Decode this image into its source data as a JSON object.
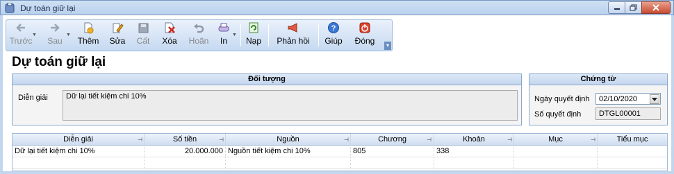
{
  "window": {
    "title": "Dự toán giữ lại"
  },
  "toolbar": {
    "buttons": [
      {
        "label": "Trước",
        "icon": "arrow-left-icon",
        "enabled": false
      },
      {
        "label": "Sau",
        "icon": "arrow-right-icon",
        "enabled": false
      },
      {
        "label": "Thêm",
        "icon": "add-document-icon",
        "enabled": true
      },
      {
        "label": "Sửa",
        "icon": "edit-icon",
        "enabled": true
      },
      {
        "label": "Cất",
        "icon": "save-disk-icon",
        "enabled": false
      },
      {
        "label": "Xóa",
        "icon": "delete-icon",
        "enabled": true
      },
      {
        "label": "Hoãn",
        "icon": "undo-icon",
        "enabled": false
      },
      {
        "label": "In",
        "icon": "printer-icon",
        "enabled": true
      },
      {
        "label": "Nạp",
        "icon": "refresh-icon",
        "enabled": true
      },
      {
        "label": "Phản hồi",
        "icon": "megaphone-icon",
        "enabled": true
      },
      {
        "label": "Giúp",
        "icon": "help-icon",
        "enabled": true
      },
      {
        "label": "Đóng",
        "icon": "power-icon",
        "enabled": true
      }
    ]
  },
  "page": {
    "title": "Dự toán giữ lại"
  },
  "doi_tuong": {
    "header": "Đối tượng",
    "dien_giai_label": "Diễn giải",
    "dien_giai_value": "Dữ lại tiết kiệm chi 10%"
  },
  "chung_tu": {
    "header": "Chứng từ",
    "ngay_label": "Ngày quyết định",
    "ngay_value": "02/10/2020",
    "so_label": "Số quyết định",
    "so_value": "DTGL00001"
  },
  "grid": {
    "columns": [
      "Diễn giải",
      "Số tiền",
      "Nguồn",
      "Chương",
      "Khoản",
      "Mục",
      "Tiểu mục"
    ],
    "rows": [
      [
        "Dữ lại tiết kiệm chi 10%",
        "20.000.000",
        "Nguồn tiết kiệm chi 10%",
        "805",
        "338",
        "",
        ""
      ]
    ]
  },
  "colors": {
    "accent": "#c3d6ef",
    "border": "#8aa6cf",
    "toolbar_bg": "#dbe7f6"
  }
}
